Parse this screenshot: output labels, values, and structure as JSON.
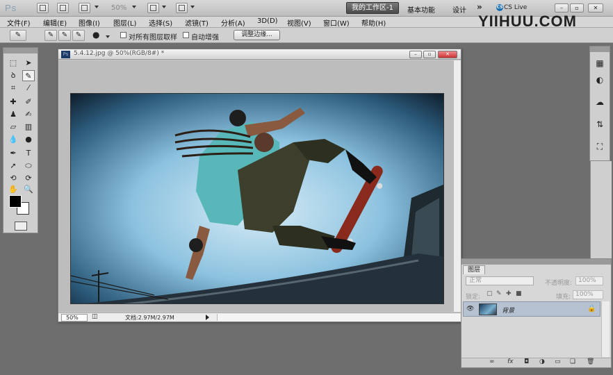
{
  "app": {
    "logo": "Ps",
    "zoom": "50%",
    "workspaces": {
      "active": "我的工作区-1",
      "basic": "基本功能",
      "design": "设计",
      "more": "»"
    },
    "cslive": "CS Live",
    "watermark": "YIIHUU.COM"
  },
  "menu": [
    "文件(F)",
    "编辑(E)",
    "图像(I)",
    "图层(L)",
    "选择(S)",
    "滤镜(T)",
    "分析(A)",
    "3D(D)",
    "视图(V)",
    "窗口(W)",
    "帮助(H)"
  ],
  "options": {
    "sample_all_layers": "对所有图层取样",
    "auto_enhance": "自动增强",
    "refine_edge": "调整边缘..."
  },
  "document": {
    "title": "5.4.12.jpg @ 50%(RGB/8#) *",
    "status_zoom": "50%",
    "status_doc": "文档:2.97M/2.97M"
  },
  "layers": {
    "tab": "图层",
    "blend": "正常",
    "opacity_label": "不透明度:",
    "opacity": "100%",
    "lock_label": "锁定:",
    "fill_label": "填充:",
    "fill": "100%",
    "layer_name": "背景"
  },
  "colors": {
    "foreground": "#000000",
    "background": "#ffffff",
    "accent": "#4a4a4a"
  }
}
